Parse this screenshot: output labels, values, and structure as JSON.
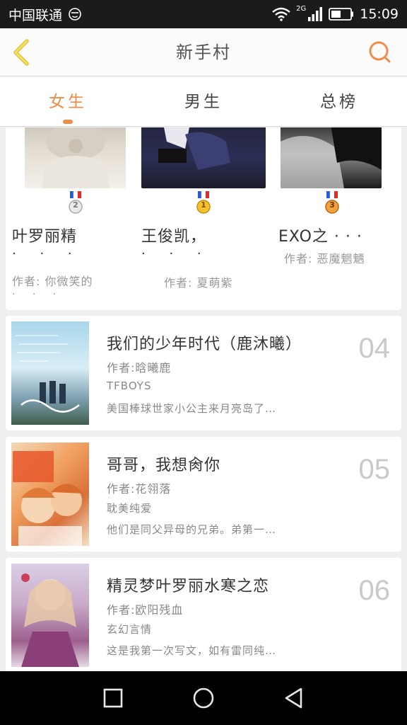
{
  "status_bar": {
    "carrier": "中国联通",
    "network": "2G",
    "time": "15:09"
  },
  "header": {
    "title": "新手村"
  },
  "tabs": [
    {
      "label": "女生",
      "active": true
    },
    {
      "label": "男生",
      "active": false
    },
    {
      "label": "总榜",
      "active": false
    }
  ],
  "top3": [
    {
      "rank": "2",
      "title": "叶罗丽精",
      "dots": "· · ·",
      "author": "作者: 你微笑的",
      "author_dots": "· · ·"
    },
    {
      "rank": "1",
      "title": "王俊凯，",
      "dots": "· · ·",
      "author": "作者: 夏萌紫"
    },
    {
      "rank": "3",
      "title": "EXO之 · · ·",
      "author": "作者: 恶魔魍魉"
    }
  ],
  "books": [
    {
      "rank": "04",
      "title": "我们的少年时代（鹿沐曦）",
      "author": "作者:晗曦鹿",
      "genre": "TFBOYS",
      "desc": "美国棒球世家小公主来月亮岛了…"
    },
    {
      "rank": "05",
      "title": "哥哥，我想肏你",
      "author": "作者:花翎落",
      "genre": "耽美纯爱",
      "desc": "他们是同父异母的兄弟。弟第一…"
    },
    {
      "rank": "06",
      "title": "精灵梦叶罗丽水寒之恋",
      "author": "作者:欧阳残血",
      "genre": "玄幻言情",
      "desc": "这是我第一次写文，如有雷同纯…"
    }
  ],
  "colors": {
    "accent": "#f08c47",
    "background": "#efefef",
    "rank_number": "#c9c9c9"
  }
}
